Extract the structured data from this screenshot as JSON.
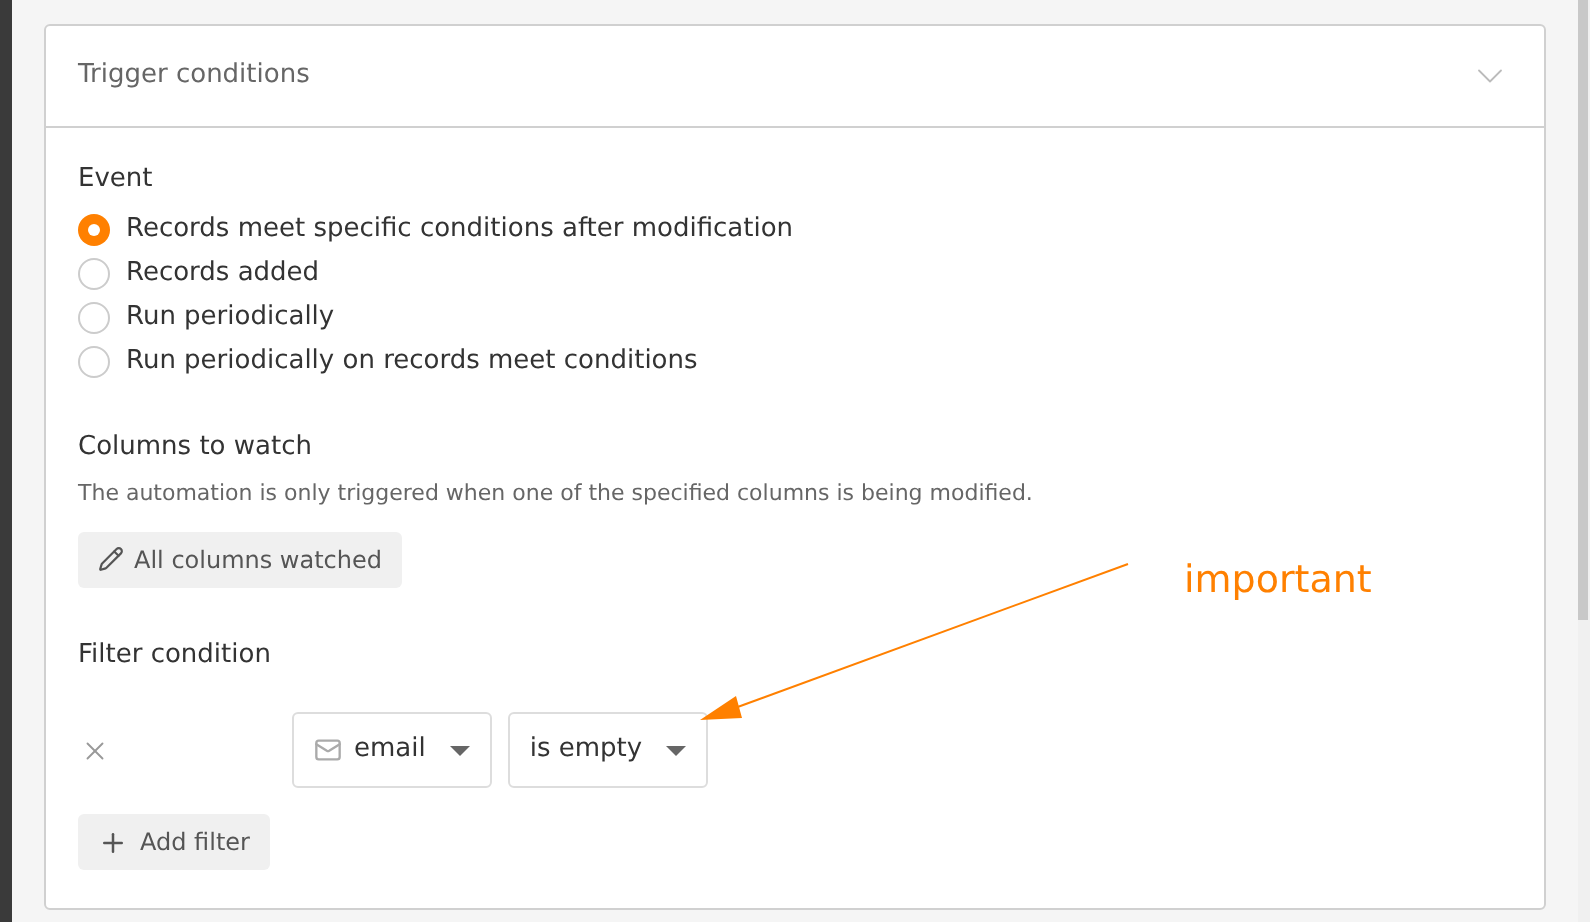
{
  "panel": {
    "title": "Trigger conditions",
    "expanded": true
  },
  "event": {
    "label": "Event",
    "options": [
      {
        "label": "Records meet specific conditions after modification",
        "selected": true
      },
      {
        "label": "Records added",
        "selected": false
      },
      {
        "label": "Run periodically",
        "selected": false
      },
      {
        "label": "Run periodically on records meet conditions",
        "selected": false
      }
    ]
  },
  "columns_to_watch": {
    "label": "Columns to watch",
    "description": "The automation is only triggered when one of the specified columns is being modified.",
    "button": "All columns watched"
  },
  "filter_condition": {
    "label": "Filter condition",
    "filters": [
      {
        "column": "email",
        "operator": "is empty"
      }
    ],
    "add_button": "Add filter"
  },
  "annotation": {
    "text": "important"
  }
}
